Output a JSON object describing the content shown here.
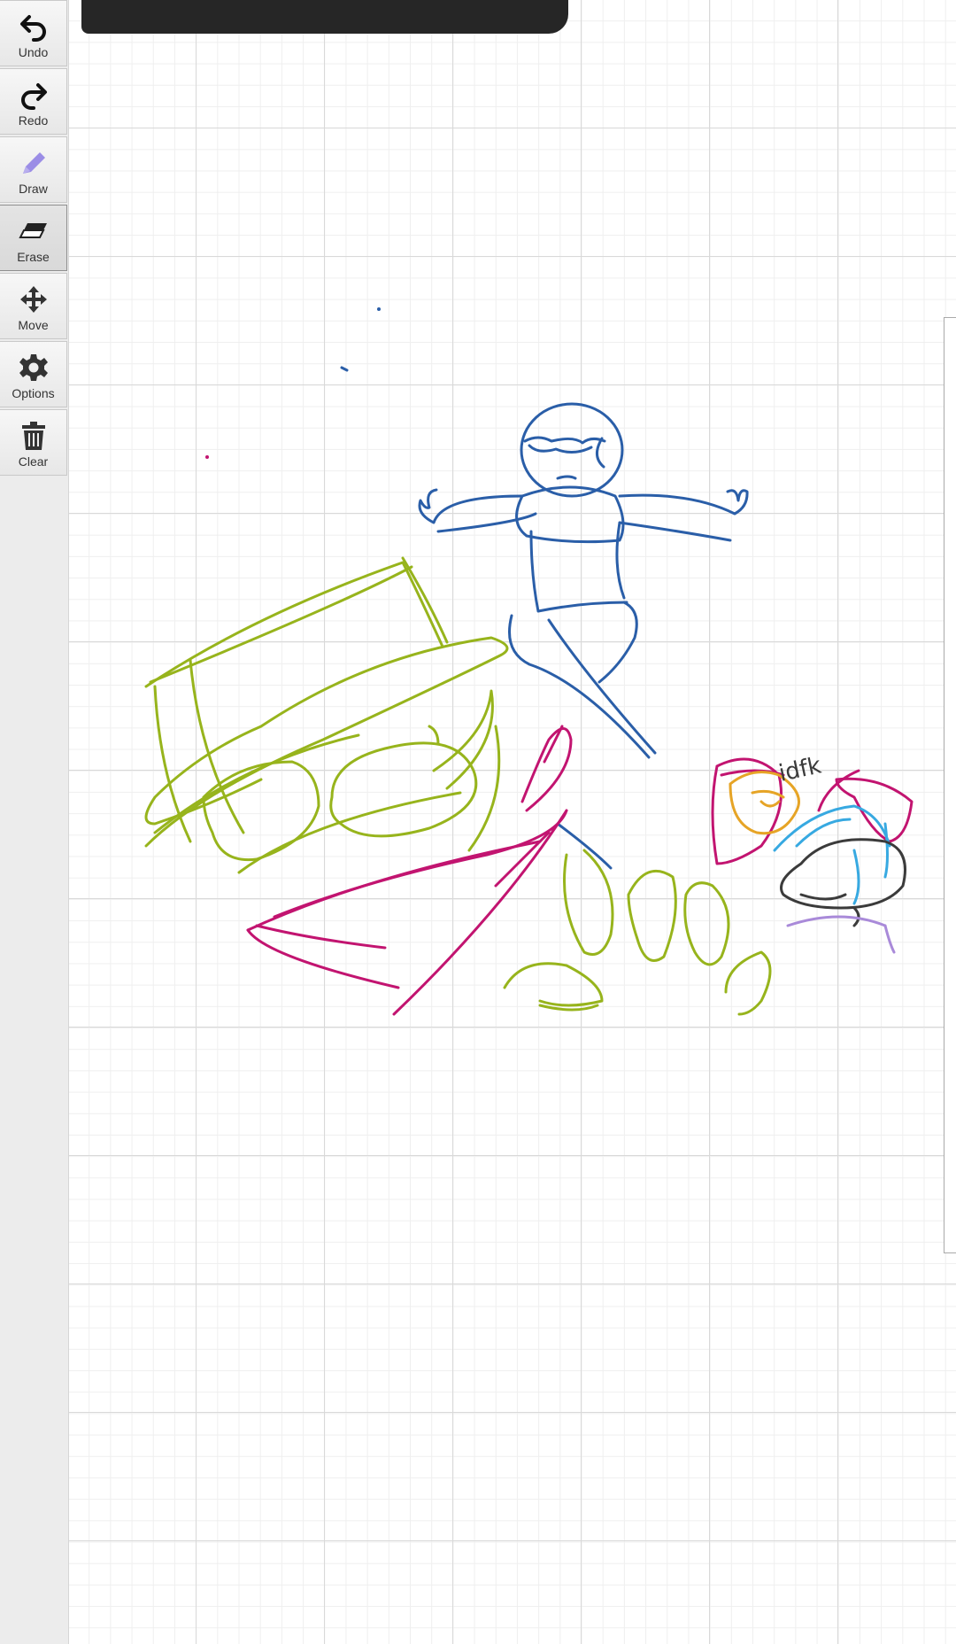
{
  "toolbar": {
    "undo_label": "Undo",
    "redo_label": "Redo",
    "draw_label": "Draw",
    "erase_label": "Erase",
    "move_label": "Move",
    "options_label": "Options",
    "clear_label": "Clear",
    "selected_tool": "Erase"
  },
  "drawing": {
    "doodle_text": "idfk"
  },
  "colors": {
    "blue": "#2a5ea8",
    "green": "#97b41c",
    "magenta": "#c21470",
    "orange": "#e6a426",
    "cyan": "#37a9e1",
    "purple": "#a98ad9",
    "gray": "#3b3b3b",
    "draw_icon": "#9b8de6"
  }
}
